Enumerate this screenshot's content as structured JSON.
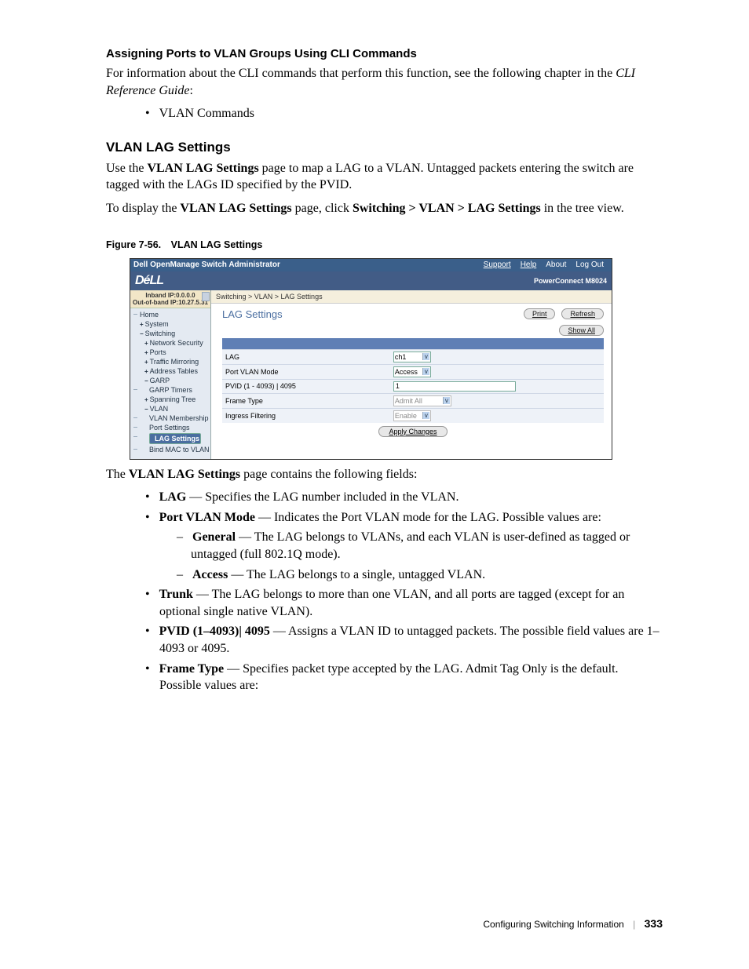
{
  "section_heading_1": "Assigning Ports to VLAN Groups Using CLI Commands",
  "para_1a": "For information about the CLI commands that perform this function, see the following chapter in the ",
  "para_1b": "CLI Reference Guide",
  "para_1c": ":",
  "bullet_vlan_commands": "VLAN Commands",
  "section_heading_2": "VLAN LAG Settings",
  "para_2a": "Use the ",
  "para_2b": "VLAN LAG Settings",
  "para_2c": " page to map a LAG to a VLAN. Untagged packets entering the switch are tagged with the LAGs ID specified by the PVID.",
  "para_3a": "To display the ",
  "para_3b": "VLAN LAG Settings",
  "para_3c": " page, click ",
  "para_3d": "Switching > VLAN > LAG Settings",
  "para_3e": " in the tree view.",
  "figure_caption": "Figure 7-56. VLAN LAG Settings",
  "screenshot": {
    "topbar_title": "Dell OpenManage Switch Administrator",
    "topbar_links": {
      "support": "Support",
      "help": "Help",
      "about": "About",
      "logout": "Log Out"
    },
    "brand_logo": "DéLL",
    "brand_right": "PowerConnect M8024",
    "ip_line1": "Inband IP:0.0.0.0",
    "ip_line2": "Out-of-band IP:10.27.5.31",
    "tree": {
      "home": "Home",
      "system": "System",
      "switching": "Switching",
      "netsec": "Network Security",
      "ports": "Ports",
      "traffic": "Traffic Mirroring",
      "addr": "Address Tables",
      "garp": "GARP",
      "garp_timers": "GARP Timers",
      "span": "Spanning Tree",
      "vlan": "VLAN",
      "vlan_mem": "VLAN Membership",
      "port_set": "Port Settings",
      "lag_set": "LAG Settings",
      "bind": "Bind MAC to VLAN"
    },
    "breadcrumb": "Switching > VLAN > LAG Settings",
    "main_title": "LAG Settings",
    "buttons": {
      "print": "Print",
      "refresh": "Refresh",
      "showall": "Show All",
      "apply": "Apply Changes"
    },
    "form": {
      "lag_label": "LAG",
      "lag_value": "ch1",
      "pvm_label": "Port VLAN Mode",
      "pvm_value": "Access",
      "pvid_label": "PVID  (1 - 4093) | 4095",
      "pvid_value": "1",
      "ft_label": "Frame Type",
      "ft_value": "Admit All",
      "if_label": "Ingress Filtering",
      "if_value": "Enable"
    }
  },
  "para_4a": "The ",
  "para_4b": "VLAN LAG Settings",
  "para_4c": " page contains the following fields:",
  "li_lag_b": "LAG",
  "li_lag_t": " — Specifies the LAG number included in the VLAN.",
  "li_pvm_b": "Port VLAN Mode",
  "li_pvm_t": " — Indicates the Port VLAN mode for the LAG. Possible values are:",
  "li_gen_b": "General",
  "li_gen_t": " — The LAG belongs to VLANs, and each VLAN is user-defined as tagged or untagged (full 802.1Q mode).",
  "li_acc_b": "Access",
  "li_acc_t": " — The LAG belongs to a single, untagged VLAN.",
  "li_trunk_b": "Trunk",
  "li_trunk_t": " — The LAG belongs to more than one VLAN, and all ports are tagged (except for an optional single native VLAN).",
  "li_pvid_b": "PVID (1–4093)| 4095",
  "li_pvid_t": " — Assigns a VLAN ID to untagged packets. The possible field values are 1–4093 or 4095.",
  "li_ft_b": "Frame Type",
  "li_ft_t": " — Specifies packet type accepted by the LAG. Admit Tag Only is the default. Possible values are:",
  "footer_text": "Configuring Switching Information",
  "page_number": "333"
}
